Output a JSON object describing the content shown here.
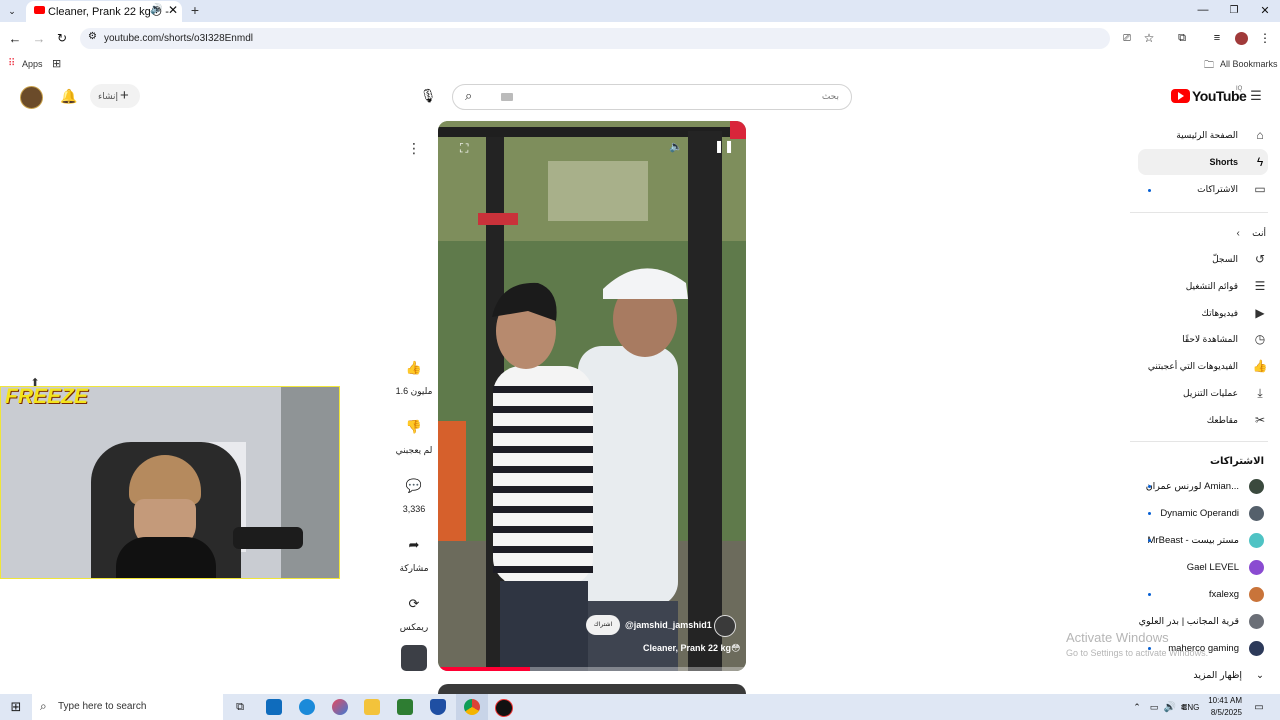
{
  "browser": {
    "tab_title": "Cleaner, Prank 22 kg😳 -",
    "url": "youtube.com/shorts/o3I328Enmdl",
    "bookmarks": {
      "apps": "Apps",
      "all_bookmarks": "All Bookmarks"
    }
  },
  "youtube": {
    "logo_text": "YouTube",
    "logo_region": "IQ",
    "create_label": "إنشاء",
    "search_placeholder": "بحث",
    "video": {
      "channel": "@jamshid_jamshid1",
      "subscribe_label": "اشتراك",
      "title": "Cleaner, Prank 22 kg😳",
      "progress": 0.3
    },
    "actions": {
      "like_count": "1.6 مليون",
      "dislike_label": "لم يعجبني",
      "comments_count": "3,336",
      "share_label": "مشاركة",
      "remix_label": "ريمكس"
    },
    "sidebar": {
      "items": [
        {
          "label": "الصفحة الرئيسية",
          "icon": "home-icon"
        },
        {
          "label": "Shorts",
          "icon": "shorts-icon"
        },
        {
          "label": "الاشتراكات",
          "icon": "subscriptions-icon"
        }
      ],
      "you_header": "أنت",
      "you_items": [
        {
          "label": "السجلّ",
          "icon": "history-icon"
        },
        {
          "label": "قوائم التشغيل",
          "icon": "playlists-icon"
        },
        {
          "label": "فيديوهاتك",
          "icon": "your-videos-icon"
        },
        {
          "label": "المشاهدة لاحقًا",
          "icon": "watch-later-icon"
        },
        {
          "label": "الفيديوهات التي أعجبتني",
          "icon": "liked-icon"
        },
        {
          "label": "عمليات التنزيل",
          "icon": "downloads-icon"
        },
        {
          "label": "مقاطعك",
          "icon": "clips-icon"
        }
      ],
      "subs_header": "الاشتراكات",
      "subscriptions": [
        {
          "name": "لورنس عمران Amian...",
          "color": "#3b4a3e"
        },
        {
          "name": "Dynamic Operandi",
          "color": "#55606b"
        },
        {
          "name": "MrBeast - مستر بيست",
          "color": "#4fc3c4"
        },
        {
          "name": "Gael LEVEL",
          "color": "#8a4bd1"
        },
        {
          "name": "fxalexg",
          "color": "#c9743a"
        },
        {
          "name": "قرية المجانب | بدر العلوي",
          "color": "#6b6f77"
        },
        {
          "name": "maherco gaming",
          "color": "#2d3a5a"
        }
      ],
      "show_more": "إظهار المزيد"
    }
  },
  "webcam": {
    "overlay_text": "FREEZE"
  },
  "watermark": {
    "line1": "Activate Windows",
    "line2": "Go to Settings to activate Windows."
  },
  "taskbar": {
    "search_placeholder": "Type here to search",
    "lang": "ENG",
    "time": "10:41 AM",
    "date": "8/5/2025"
  }
}
